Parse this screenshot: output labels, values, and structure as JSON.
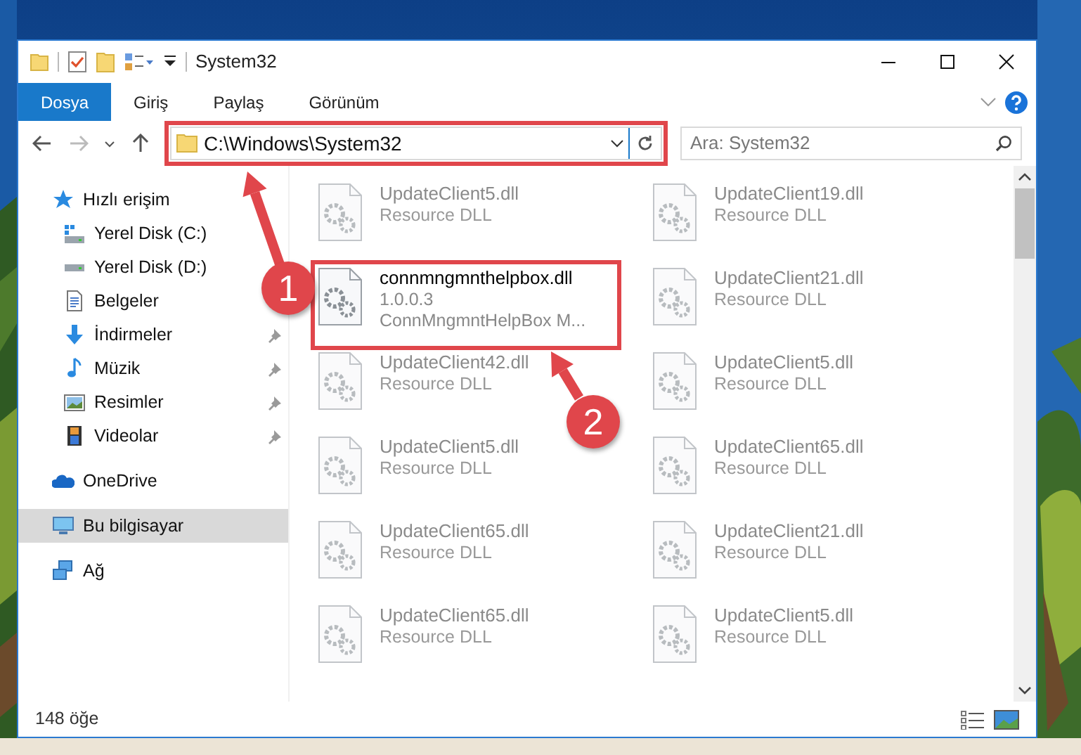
{
  "window": {
    "title": "System32"
  },
  "ribbon_tabs": [
    {
      "label": "Dosya",
      "selected": true
    },
    {
      "label": "Giriş",
      "selected": false
    },
    {
      "label": "Paylaş",
      "selected": false
    },
    {
      "label": "Görünüm",
      "selected": false
    }
  ],
  "address": {
    "path": "C:\\Windows\\System32",
    "highlighted": true
  },
  "search": {
    "placeholder": "Ara: System32"
  },
  "sidebar": {
    "items": [
      {
        "label": "Hızlı erişim",
        "kind": "quick",
        "selected": false,
        "children": [
          {
            "label": "Yerel Disk (C:)",
            "kind": "system",
            "selected": false,
            "pinned": false
          },
          {
            "label": "Yerel Disk (D:)",
            "kind": "drive",
            "selected": false,
            "pinned": false
          },
          {
            "label": "Belgeler",
            "kind": "docs",
            "selected": false,
            "pinned": false
          },
          {
            "label": "İndirmeler",
            "kind": "downloads",
            "selected": false,
            "pinned": true
          },
          {
            "label": "Müzik",
            "kind": "music",
            "selected": false,
            "pinned": true
          },
          {
            "label": "Resimler",
            "kind": "pictures",
            "selected": false,
            "pinned": true
          },
          {
            "label": "Videolar",
            "kind": "videos",
            "selected": false,
            "pinned": true
          }
        ]
      },
      {
        "label": "OneDrive",
        "kind": "cloud",
        "selected": false
      },
      {
        "label": "Bu bilgisayar",
        "kind": "pc",
        "selected": true
      },
      {
        "label": "Ağ",
        "kind": "network",
        "selected": false
      }
    ]
  },
  "files": [
    {
      "name": "UpdateClient5.dll",
      "details": [
        "Resource DLL"
      ],
      "kind": "blurred",
      "highlighted": false
    },
    {
      "name": "UpdateClient19.dll",
      "details": [
        "Resource DLL"
      ],
      "kind": "blurred",
      "highlighted": false
    },
    {
      "name": "connmngmnthelpbox.dll",
      "details": [
        "1.0.0.3",
        "ConnMngmntHelpBox M..."
      ],
      "kind": "clear",
      "highlighted": true
    },
    {
      "name": "UpdateClient21.dll",
      "details": [
        "Resource DLL"
      ],
      "kind": "blurred",
      "highlighted": false
    },
    {
      "name": "UpdateClient42.dll",
      "details": [
        "Resource DLL"
      ],
      "kind": "blurred",
      "highlighted": false
    },
    {
      "name": "UpdateClient5.dll",
      "details": [
        "Resource DLL"
      ],
      "kind": "blurred",
      "highlighted": false
    },
    {
      "name": "UpdateClient5.dll",
      "details": [
        "Resource DLL"
      ],
      "kind": "blurred",
      "highlighted": false
    },
    {
      "name": "UpdateClient65.dll",
      "details": [
        "Resource DLL"
      ],
      "kind": "blurred",
      "highlighted": false
    },
    {
      "name": "UpdateClient65.dll",
      "details": [
        "Resource DLL"
      ],
      "kind": "blurred",
      "highlighted": false
    },
    {
      "name": "UpdateClient21.dll",
      "details": [
        "Resource DLL"
      ],
      "kind": "blurred",
      "highlighted": false
    },
    {
      "name": "UpdateClient65.dll",
      "details": [
        "Resource DLL"
      ],
      "kind": "blurred",
      "highlighted": false
    },
    {
      "name": "UpdateClient5.dll",
      "details": [
        "Resource DLL"
      ],
      "kind": "blurred",
      "highlighted": false
    }
  ],
  "status_bar": {
    "count": "148 öğe"
  },
  "annotations": [
    {
      "label": "1"
    },
    {
      "label": "2"
    }
  ]
}
